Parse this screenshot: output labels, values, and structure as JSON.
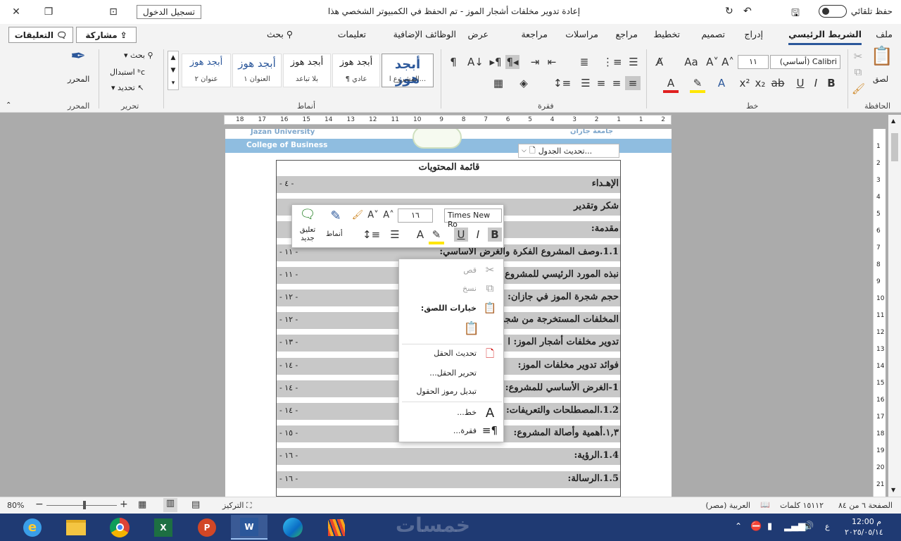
{
  "titlebar": {
    "autosave_label": "حفظ تلقائي",
    "document_title": "إعادة تدوير مخلفات أشجار الموز  -  تم الحفظ في الكمبيوتر الشخصي هذا",
    "signin_label": "تسجيل الدخول"
  },
  "tabs": [
    "ملف",
    "الشريط الرئيسي",
    "إدراج",
    "تصميم",
    "تخطيط",
    "مراجع",
    "مراسلات",
    "مراجعة",
    "عرض",
    "الوظائف الإضافية",
    "تعليمات",
    "بحث"
  ],
  "active_tab": "الشريط الرئيسي",
  "share_label": "مشاركة",
  "comments_label": "التعليقات",
  "ribbon": {
    "clipboard": {
      "label": "الحافظة",
      "paste": "لصق"
    },
    "font": {
      "label": "خط",
      "font_name": "Calibri (أساسي)",
      "font_size": "١١"
    },
    "paragraph": {
      "label": "فقرة"
    },
    "styles": {
      "label": "أنماط",
      "items": [
        {
          "preview": "أبجد هوز",
          "name": "المشروع ا..."
        },
        {
          "preview": "أبجد هوز",
          "name": "¶ عادي"
        },
        {
          "preview": "أبجد هوز",
          "name": "بلا تباعد"
        },
        {
          "preview": "أبجد هوز",
          "name": "العنوان ١"
        },
        {
          "preview": "أبجد هوز",
          "name": "عنوان ٢"
        }
      ]
    },
    "editing": {
      "label": "تحرير",
      "find": "بحث",
      "replace": "استبدال",
      "select": "تحديد"
    },
    "editor": {
      "label": "المحرر",
      "button": "المحرر"
    }
  },
  "ruler_numbers": [
    "2",
    "1",
    "1",
    "2",
    "3",
    "4",
    "5",
    "6",
    "7",
    "8",
    "9",
    "10",
    "11",
    "12",
    "13",
    "14",
    "15",
    "16",
    "17",
    "18"
  ],
  "vruler_numbers": [
    "1",
    "2",
    "3",
    "4",
    "5",
    "6",
    "7",
    "8",
    "9",
    "10",
    "11",
    "12",
    "13",
    "14",
    "15",
    "16",
    "17",
    "18",
    "19",
    "20",
    "21"
  ],
  "page": {
    "uni_en": "College of Business",
    "uni_name_en": "Jazan University",
    "uni_name_ar": "جامعة جازان",
    "toc_title": "قائمة المحتويات",
    "rows": [
      {
        "label": "الإهـداء",
        "page": "٤"
      },
      {
        "label": "شكر وتقدير",
        "page": ""
      },
      {
        "label": "مقدمة:",
        "page": ""
      },
      {
        "label": "1.1.وصف المشروع  الفكرة والغرض الأساسي:",
        "page": "١١"
      },
      {
        "label": "نبذه المورد الرئيسي للمشروع",
        "page": "١١"
      },
      {
        "label": "حجم شجرة الموز في جازان:",
        "page": "١٢"
      },
      {
        "label": "المخلفات المستخرجة من شجر",
        "page": "١٢"
      },
      {
        "label": "تدوير مخلفات أشجار الموز: ا",
        "page": "١٣"
      },
      {
        "label": "فوائد تدوير مخلفات الموز:",
        "page": "١٤"
      },
      {
        "label": "1-الغرض الأساسي للمشروع:",
        "page": "١٤"
      },
      {
        "label": "1.2.المصطلحات والتعريفات:",
        "page": "١٤"
      },
      {
        "label": "١,٣.أهمية وأصالة المشروع:",
        "page": "١٥"
      },
      {
        "label": "1.4.الرؤية:",
        "page": "١٦"
      },
      {
        "label": "1.5.الرسالة:",
        "page": "١٦"
      }
    ]
  },
  "table_update_label": "تحديث الجدول...",
  "mini_toolbar": {
    "font_name": "Times New Ro",
    "font_size": "١٦",
    "styles_label": "أنماط",
    "new_comment_label": "تعليق جديد"
  },
  "context_menu": {
    "cut": "قص",
    "copy": "نسخ",
    "paste_options": "خيارات اللصق:",
    "update_field": "تحديث الحقل",
    "edit_field": "تحرير الحقل...",
    "toggle_codes": "تبديل رموز الحقول",
    "font": "خط...",
    "paragraph": "فقرة..."
  },
  "status": {
    "page_info": "الصفحة ٦ من ٨٤",
    "words": "١٥١١٢ كلمات",
    "language": "العربية (مصر)",
    "focus": "التركيز",
    "zoom": "80%"
  },
  "taskbar": {
    "time": "12:00 م",
    "date": "٢٠٢٥/٠٥/١٤",
    "lang": "ع",
    "watermark": "خمسات"
  }
}
